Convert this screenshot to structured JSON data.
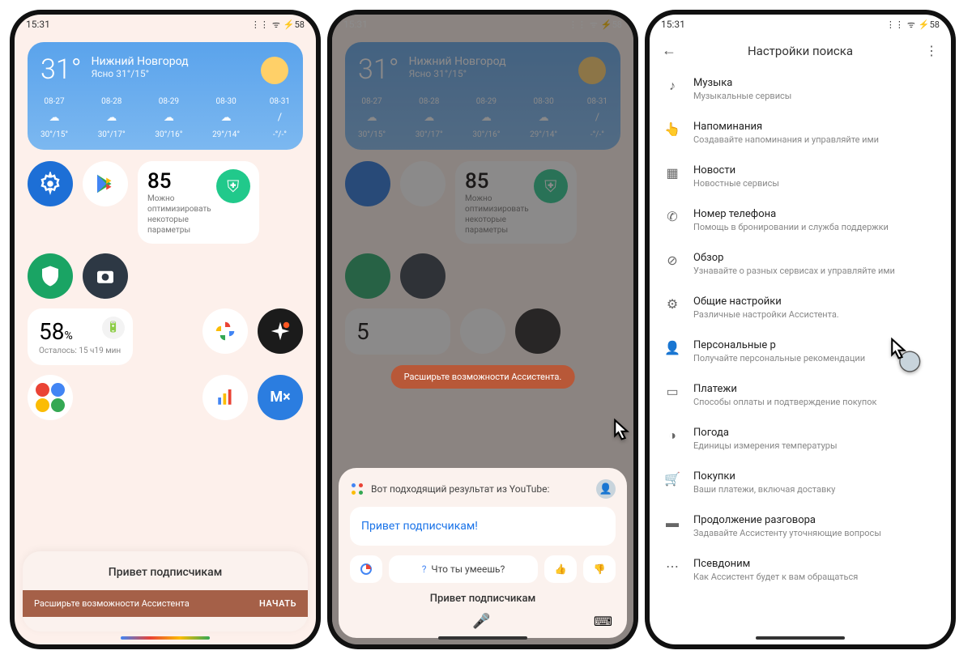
{
  "status": {
    "time": "15:31",
    "alarm": "⦸",
    "signal": "⋮⋮",
    "wifi": "ᯤ",
    "battery": "58"
  },
  "weather": {
    "temp": "31°",
    "city": "Нижний Новгород",
    "cond": "Ясно  31°/15°",
    "days": [
      {
        "date": "08-27",
        "icon": "☁",
        "hl": "30°/15°"
      },
      {
        "date": "08-28",
        "icon": "☁",
        "hl": "30°/17°"
      },
      {
        "date": "08-29",
        "icon": "☁",
        "hl": "30°/16°"
      },
      {
        "date": "08-30",
        "icon": "☁",
        "hl": "29°/14°"
      },
      {
        "date": "08-31",
        "icon": "/",
        "hl": "-°/-°"
      }
    ]
  },
  "optimize": {
    "score": "85",
    "text": "Можно оптимизировать некоторые параметры"
  },
  "battery": {
    "pct": "58",
    "unit": "%",
    "sub": "Осталось: 15 ч19 мин"
  },
  "assistant1": {
    "greeting": "Привет подписчикам",
    "banner": "Расширьте возможности Ассистента",
    "action": "НАЧАТЬ"
  },
  "assistant2": {
    "toast": "Расширьте возможности Ассистента.",
    "head": "Вот подходящий результат из YouTube:",
    "reply": "Привет подписчикам!",
    "chip_help": "Что ты умеешь?",
    "greeting": "Привет подписчикам"
  },
  "settings": {
    "title": "Настройки поиска",
    "items": [
      {
        "icon": "♪",
        "title": "Музыка",
        "sub": "Музыкальные сервисы"
      },
      {
        "icon": "👆",
        "title": "Напоминания",
        "sub": "Создавайте напоминания и управляйте ими"
      },
      {
        "icon": "▦",
        "title": "Новости",
        "sub": "Новостные сервисы"
      },
      {
        "icon": "✆",
        "title": "Номер телефона",
        "sub": "Помощь в бронировании и служба поддержки"
      },
      {
        "icon": "⊘",
        "title": "Обзор",
        "sub": "Узнавайте о разных сервисах и управляйте ими"
      },
      {
        "icon": "⚙",
        "title": "Общие настройки",
        "sub": "Различные настройки Ассистента."
      },
      {
        "icon": "👤",
        "title": "Персональные р",
        "sub": "Получайте персональные рекомендации"
      },
      {
        "icon": "▭",
        "title": "Платежи",
        "sub": "Способы оплаты и подтверждение покупок"
      },
      {
        "icon": "◑",
        "title": "Погода",
        "sub": "Единицы измерения температуры"
      },
      {
        "icon": "🛒",
        "title": "Покупки",
        "sub": "Ваши платежи, включая доставку"
      },
      {
        "icon": "▬",
        "title": "Продолжение разговора",
        "sub": "Задавайте Ассистенту уточняющие вопросы"
      },
      {
        "icon": "⋯",
        "title": "Псевдоним",
        "sub": "Как Ассистент будет к вам обращаться"
      }
    ]
  }
}
